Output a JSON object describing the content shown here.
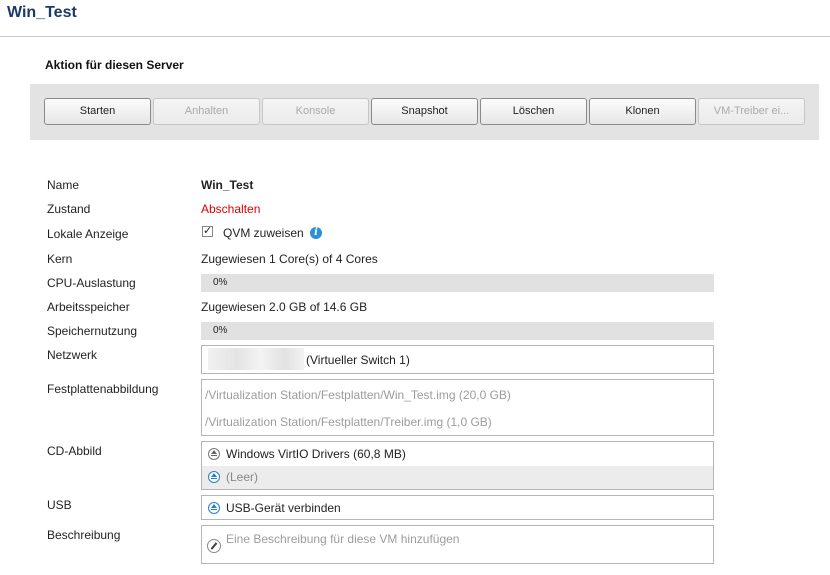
{
  "window": {
    "title": "Win_Test"
  },
  "section": {
    "title": "Aktion für diesen Server"
  },
  "toolbar": {
    "buttons": [
      {
        "label": "Starten",
        "enabled": true
      },
      {
        "label": "Anhalten",
        "enabled": false
      },
      {
        "label": "Konsole",
        "enabled": false
      },
      {
        "label": "Snapshot",
        "enabled": true
      },
      {
        "label": "Löschen",
        "enabled": true
      },
      {
        "label": "Klonen",
        "enabled": true
      },
      {
        "label": "VM-Treiber ei...",
        "enabled": false
      }
    ]
  },
  "details": {
    "name": {
      "label": "Name",
      "value": "Win_Test"
    },
    "state": {
      "label": "Zustand",
      "value": "Abschalten",
      "color": "#e00000"
    },
    "local_display": {
      "label": "Lokale Anzeige",
      "checkbox_label": "QVM zuweisen",
      "checked": true
    },
    "core": {
      "label": "Kern",
      "value": "Zugewiesen 1 Core(s) of 4 Cores"
    },
    "cpu": {
      "label": "CPU-Auslastung",
      "value": "0%",
      "percent": 0
    },
    "memory": {
      "label": "Arbeitsspeicher",
      "value": "Zugewiesen 2.0 GB of 14.6 GB"
    },
    "memory_usage": {
      "label": "Speichernutzung",
      "value": "0%",
      "percent": 0
    },
    "network": {
      "label": "Netzwerk",
      "value": "(Virtueller Switch 1)"
    },
    "disk_image": {
      "label": "Festplattenabbildung",
      "items": [
        "/Virtualization Station/Festplatten/Win_Test.img (20,0 GB)",
        "/Virtualization Station/Festplatten/Treiber.img (1,0 GB)"
      ]
    },
    "cd_image": {
      "label": "CD-Abbild",
      "items": [
        "Windows VirtIO Drivers (60,8 MB)",
        "(Leer)"
      ]
    },
    "usb": {
      "label": "USB",
      "value": "USB-Gerät verbinden"
    },
    "description": {
      "label": "Beschreibung",
      "placeholder": "Eine Beschreibung für diese VM hinzufügen"
    }
  },
  "colors": {
    "title": "#1d3a66",
    "accent": "#2a8fd8",
    "state": "#e00000"
  }
}
